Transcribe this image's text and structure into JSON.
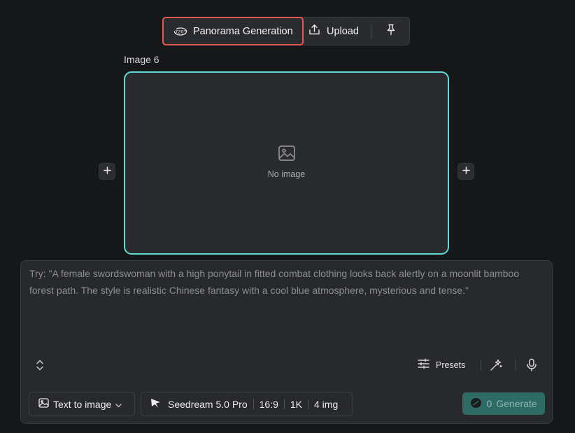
{
  "toolbar": {
    "panorama_label": "Panorama Generation",
    "panorama_badge": "720°",
    "upload_label": "Upload",
    "panorama_highlight_color": "#e05a55"
  },
  "canvas": {
    "image_label": "Image 6",
    "empty_text": "No image",
    "border_color": "#5fd8d6"
  },
  "prompt": {
    "placeholder": "Try: \"A female swordswoman with a high ponytail in fitted combat clothing looks back alertly on a moonlit bamboo forest path. The style is realistic Chinese fantasy with a cool blue atmosphere, mysterious and tense.\""
  },
  "controls": {
    "presets_label": "Presets"
  },
  "mode": {
    "selected": "Text to image"
  },
  "model": {
    "name": "Seedream 5.0 Pro",
    "aspect_ratio": "16:9",
    "resolution": "1K",
    "count": "4 img"
  },
  "generate": {
    "cost": "0",
    "label": "Generate",
    "color": "#2e6b64"
  }
}
